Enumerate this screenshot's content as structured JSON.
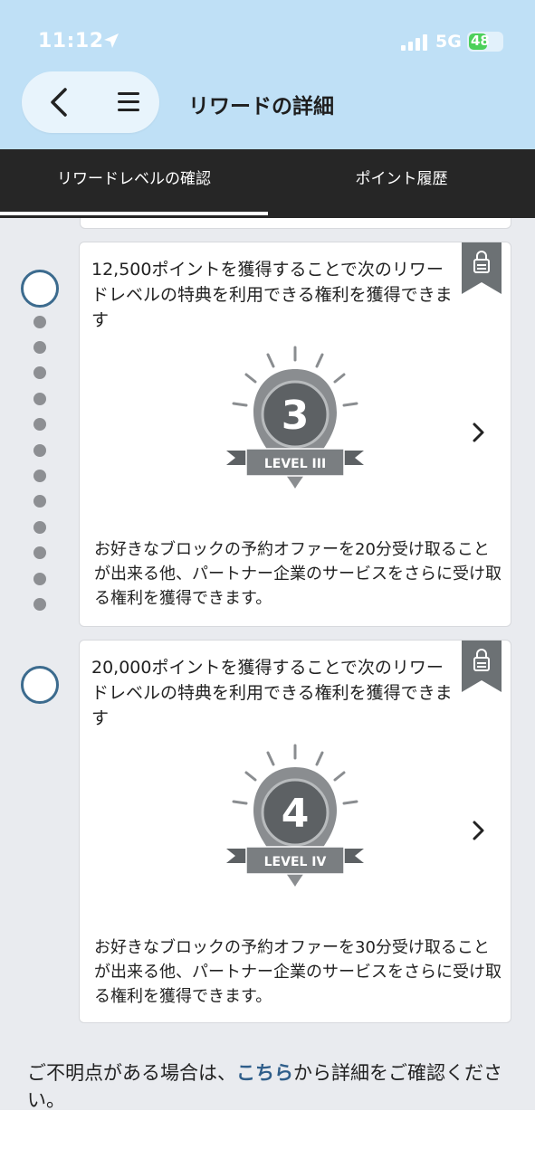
{
  "status": {
    "time": "11:12",
    "network": "5G",
    "battery": "48"
  },
  "header": {
    "title": "リワードの詳細"
  },
  "tabs": [
    {
      "label": "リワードレベルの確認",
      "active": true
    },
    {
      "label": "ポイント履歴",
      "active": false
    }
  ],
  "levels": [
    {
      "title": "12,500ポイントを獲得することで次のリワードレベルの特典を利用できる権利を獲得できます",
      "badge_number": "3",
      "badge_label": "LEVEL III",
      "description": "お好きなブロックの予約オファーを20分受け取ることが出来る他、パートナー企業のサービスをさらに受け取る権利を獲得できます。",
      "locked": true
    },
    {
      "title": "20,000ポイントを獲得することで次のリワードレベルの特典を利用できる権利を獲得できます",
      "badge_number": "4",
      "badge_label": "LEVEL IV",
      "description": "お好きなブロックの予約オファーを30分受け取ることが出来る他、パートナー企業のサービスをさらに受け取る権利を獲得できます。",
      "locked": true
    }
  ],
  "footer": {
    "prefix": "ご不明点がある場合は、",
    "link": "こちら",
    "suffix": "から詳細をご確認ください。"
  },
  "colors": {
    "header_bg": "#bfe0f6",
    "tab_bg": "#262626",
    "content_bg": "#e9ebef",
    "accent_ring": "#3c6b8e",
    "link": "#2f5e8a",
    "badge_gray": "#8a8d90"
  }
}
